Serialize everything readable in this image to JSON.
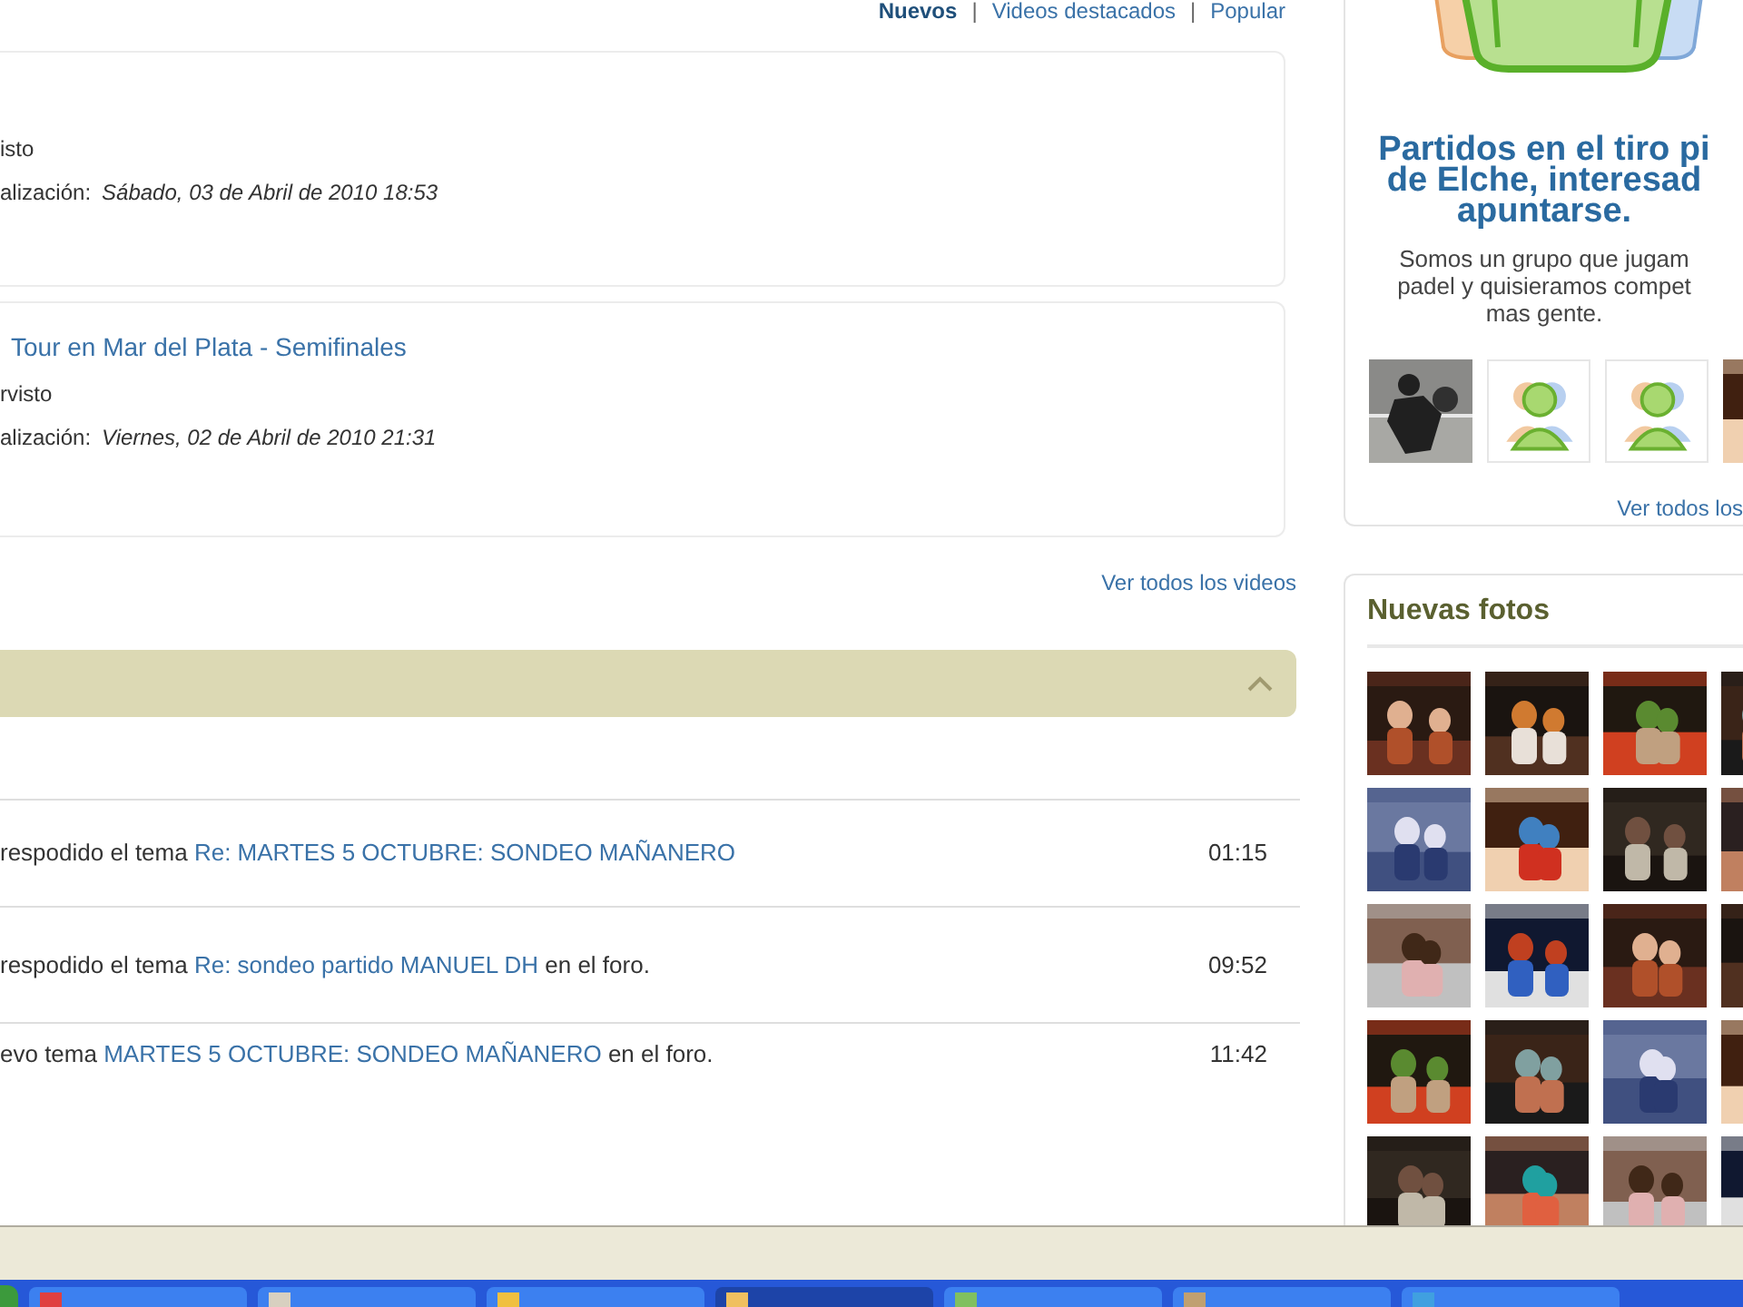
{
  "video_tab_separator": "|",
  "video_tabs": [
    {
      "label": "Nuevos",
      "selected": true
    },
    {
      "label": "Videos destacados",
      "selected": false
    },
    {
      "label": "Popular",
      "selected": false
    }
  ],
  "videos": [
    {
      "views": "isto",
      "updated_label": "alización:",
      "updated": "Sábado, 03 de Abril de 2010 18:53"
    },
    {
      "title": "Tour en Mar del Plata - Semifinales",
      "views": "rvisto",
      "updated_label": "alización:",
      "updated": "Viernes, 02 de Abril de 2010 21:31"
    }
  ],
  "videos_link": "Ver todos los videos",
  "activity_panel": {
    "expanded": true
  },
  "activity": [
    {
      "prefix": "respodido el tema ",
      "link": "Re: MARTES 5 OCTUBRE: SONDEO MAÑANERO",
      "time": "01:15"
    },
    {
      "prefix": "respodido el tema ",
      "link": "Re: sondeo partido MANUEL DH",
      "suffix": " en el foro.",
      "time": "09:52"
    },
    {
      "prefix": "evo tema ",
      "link": "MARTES 5 OCTUBRE: SONDEO MAÑANERO",
      "suffix": " en el foro.",
      "time": "11:42"
    }
  ],
  "group": {
    "title_lines": [
      "Partidos en el tiro pi",
      "de Elche, interesad",
      "apuntarse."
    ],
    "description_lines": [
      "Somos un grupo que jugam",
      "padel y quisieramos compet",
      "mas gente."
    ],
    "members": [
      {
        "kind": "picture"
      },
      {
        "kind": "avatar"
      },
      {
        "kind": "avatar"
      },
      {
        "kind": "picture"
      }
    ],
    "link": "Ver todos los"
  },
  "photos": {
    "title": "Nuevas fotos",
    "items": [
      {
        "kind": "picture"
      },
      {
        "kind": "picture"
      },
      {
        "kind": "picture"
      },
      {
        "kind": "picture"
      },
      {
        "kind": "picture"
      },
      {
        "kind": "picture"
      },
      {
        "kind": "picture"
      },
      {
        "kind": "picture"
      },
      {
        "kind": "picture"
      },
      {
        "kind": "picture"
      },
      {
        "kind": "picture"
      },
      {
        "kind": "picture"
      },
      {
        "kind": "picture"
      },
      {
        "kind": "picture"
      },
      {
        "kind": "picture"
      },
      {
        "kind": "picture"
      },
      {
        "kind": "picture"
      },
      {
        "kind": "picture"
      },
      {
        "kind": "picture"
      },
      {
        "kind": "picture"
      }
    ]
  },
  "taskbar": {
    "buttons": [
      {
        "selected": false
      },
      {
        "selected": false
      },
      {
        "selected": false
      },
      {
        "selected": true
      },
      {
        "selected": false
      },
      {
        "selected": false
      },
      {
        "selected": false
      }
    ]
  }
}
